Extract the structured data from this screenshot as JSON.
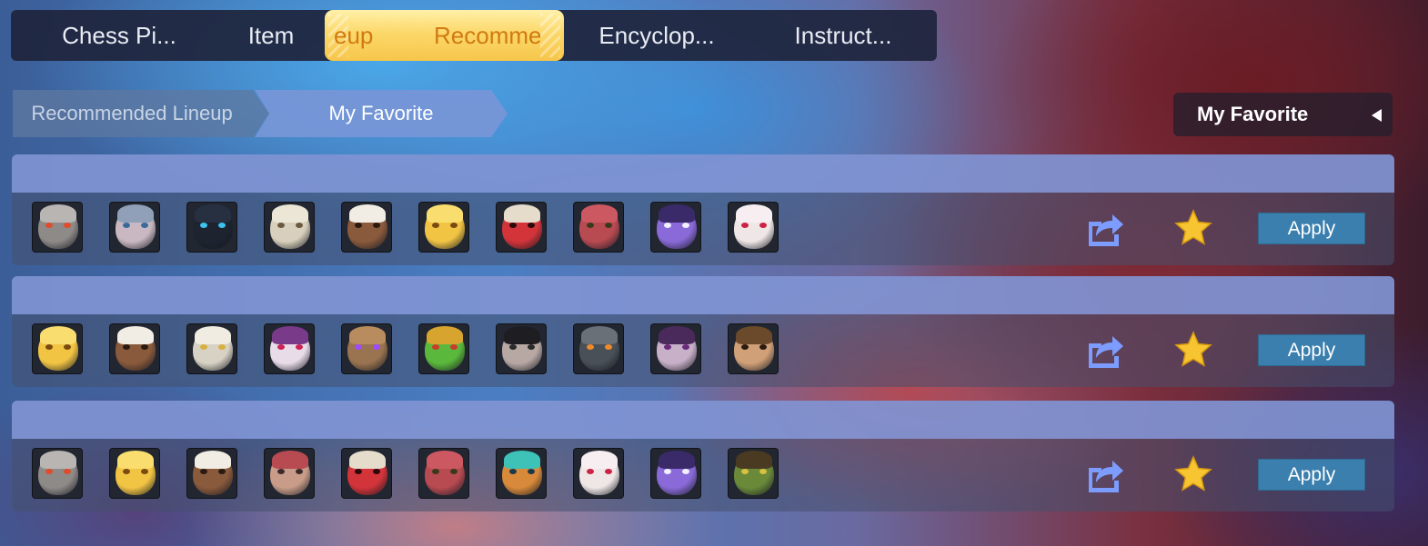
{
  "top_tabs": [
    "Chess Pi...",
    "Item",
    "eup",
    "Recomme",
    "Encyclop...",
    "Instruct..."
  ],
  "sub_tabs": [
    "Recommended Lineup",
    "My Favorite"
  ],
  "dropdown": {
    "selected": "My Favorite",
    "caret_icon": "caret-left-icon"
  },
  "colors": {
    "active_tab_bg": "#fcd86a",
    "active_tab_text": "#d07a10",
    "apply_button": "#3b7fae",
    "share_icon": "#7d9cff",
    "star_icon": "#f7c531"
  },
  "lineups": [
    {
      "heroes": [
        {
          "icon": "stone-golem-hero-icon",
          "face": "#8e8a88",
          "hat": "#b9b5b2",
          "eye": "#e04b2c"
        },
        {
          "icon": "robot-helmet-hero-icon",
          "face": "#c9b8c2",
          "hat": "#8fa0b8",
          "eye": "#3a6a9a"
        },
        {
          "icon": "dark-visor-hero-icon",
          "face": "#1d2430",
          "hat": "#263040",
          "eye": "#3cc3f0"
        },
        {
          "icon": "white-beard-sage-hero-icon",
          "face": "#d8d0bc",
          "hat": "#ece6d6",
          "eye": "#6a5a40"
        },
        {
          "icon": "turban-hero-icon",
          "face": "#8a5a3c",
          "hat": "#f2ede4",
          "eye": "#2a1a10"
        },
        {
          "icon": "golden-knight-hero-icon",
          "face": "#f2c444",
          "hat": "#f9dd6e",
          "eye": "#7a4a10"
        },
        {
          "icon": "red-demon-hero-icon",
          "face": "#d2343a",
          "hat": "#e6dccc",
          "eye": "#2a0a0a"
        },
        {
          "icon": "masked-assassin-hero-icon",
          "face": "#b84a52",
          "hat": "#cc5862",
          "eye": "#3a3a1a"
        },
        {
          "icon": "horned-witch-hero-icon",
          "face": "#8a6ad8",
          "hat": "#3a2a6a",
          "eye": "#f0f0ff"
        },
        {
          "icon": "white-mask-hero-icon",
          "face": "#efe6e6",
          "hat": "#f6eef0",
          "eye": "#cc2244"
        }
      ],
      "share_icon": "share-icon",
      "favorite_icon": "star-icon",
      "apply_label": "Apply"
    },
    {
      "heroes": [
        {
          "icon": "golden-knight-hero-icon",
          "face": "#f2c444",
          "hat": "#f9dd6e",
          "eye": "#7a4a10"
        },
        {
          "icon": "turban-hero-icon",
          "face": "#8a5a3c",
          "hat": "#f2ede4",
          "eye": "#2a1a10"
        },
        {
          "icon": "thunder-elder-hero-icon",
          "face": "#d8d2c4",
          "hat": "#f0ece2",
          "eye": "#d8b040"
        },
        {
          "icon": "pale-mask-hero-icon",
          "face": "#e8dce8",
          "hat": "#7a3a8a",
          "eye": "#cc2255"
        },
        {
          "icon": "tree-ent-hero-icon",
          "face": "#9a7450",
          "hat": "#b88c5e",
          "eye": "#a04aff"
        },
        {
          "icon": "frog-warrior-hero-icon",
          "face": "#5ab83c",
          "hat": "#d8a430",
          "eye": "#cc3a2a"
        },
        {
          "icon": "dark-hair-hero-icon",
          "face": "#b8a8a4",
          "hat": "#1e1e22",
          "eye": "#2a2a2a"
        },
        {
          "icon": "stone-box-hero-icon",
          "face": "#4a5058",
          "hat": "#6a7078",
          "eye": "#f08a2a"
        },
        {
          "icon": "purple-hood-hero-icon",
          "face": "#c8b0c8",
          "hat": "#4a2a5a",
          "eye": "#6a2a7a"
        },
        {
          "icon": "brown-hair-hero-icon",
          "face": "#d0a078",
          "hat": "#6a4a2a",
          "eye": "#2a1a10"
        }
      ],
      "share_icon": "share-icon",
      "favorite_icon": "star-icon",
      "apply_label": "Apply"
    },
    {
      "heroes": [
        {
          "icon": "stone-golem-hero-icon",
          "face": "#8e8a88",
          "hat": "#b9b5b2",
          "eye": "#e04b2c"
        },
        {
          "icon": "golden-knight-hero-icon",
          "face": "#f2c444",
          "hat": "#f9dd6e",
          "eye": "#7a4a10"
        },
        {
          "icon": "turban-hero-icon",
          "face": "#8a5a3c",
          "hat": "#f2ede4",
          "eye": "#2a1a10"
        },
        {
          "icon": "fox-mask-hero-icon",
          "face": "#c89c88",
          "hat": "#b84a52",
          "eye": "#3a2a2a"
        },
        {
          "icon": "red-demon-hero-icon",
          "face": "#d2343a",
          "hat": "#e6dccc",
          "eye": "#2a0a0a"
        },
        {
          "icon": "masked-assassin-hero-icon",
          "face": "#b84a52",
          "hat": "#cc5862",
          "eye": "#3a3a1a"
        },
        {
          "icon": "cyan-helmet-hero-icon",
          "face": "#d88a3a",
          "hat": "#3ec2b8",
          "eye": "#1a3a4a"
        },
        {
          "icon": "white-mask-hero-icon",
          "face": "#efe6e6",
          "hat": "#f6eef0",
          "eye": "#cc2244"
        },
        {
          "icon": "horned-witch-hero-icon",
          "face": "#8a6ad8",
          "hat": "#3a2a6a",
          "eye": "#f0f0ff"
        },
        {
          "icon": "goblin-pirate-hero-icon",
          "face": "#6a8a3a",
          "hat": "#4a3a22",
          "eye": "#d8c040"
        }
      ],
      "share_icon": "share-icon",
      "favorite_icon": "star-icon",
      "apply_label": "Apply"
    }
  ]
}
